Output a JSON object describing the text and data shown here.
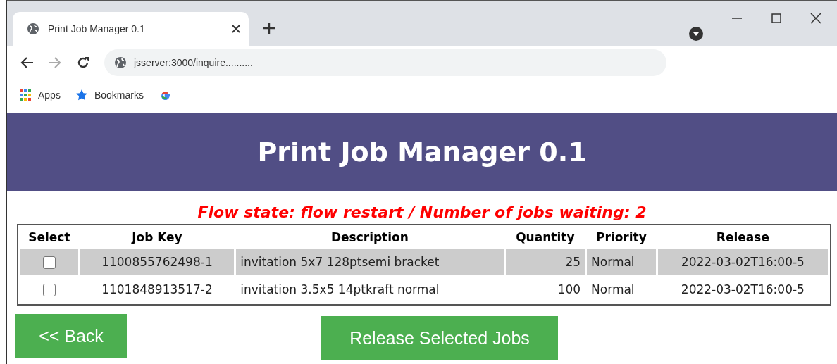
{
  "browser": {
    "tab_title": "Print Job Manager 0.1",
    "address": "jsserver:3000/inquire..........",
    "bookmarks": [
      {
        "kind": "apps",
        "label": "Apps"
      },
      {
        "kind": "star",
        "label": "Bookmarks"
      },
      {
        "kind": "google"
      }
    ]
  },
  "header": {
    "title": "Print Job Manager 0.1"
  },
  "status_line": "Flow state: flow restart / Number of jobs waiting: 2",
  "table": {
    "columns": [
      "Select",
      "Job Key",
      "Description",
      "Quantity",
      "Priority",
      "Release"
    ],
    "rows": [
      {
        "checked": false,
        "highlighted": true,
        "job_key": "1100855762498-1",
        "description": "invitation 5x7 128ptsemi bracket",
        "quantity": "25",
        "priority": "Normal",
        "release": "2022-03-02T16:00-5"
      },
      {
        "checked": false,
        "highlighted": false,
        "job_key": "1101848913517-2",
        "description": "invitation 3.5x5 14ptkraft normal",
        "quantity": "100",
        "priority": "Normal",
        "release": "2022-03-02T16:00-5"
      }
    ]
  },
  "buttons": [
    {
      "kind": "back",
      "label": "<< Back"
    },
    {
      "kind": "release",
      "label": "Release Selected Jobs"
    }
  ]
}
